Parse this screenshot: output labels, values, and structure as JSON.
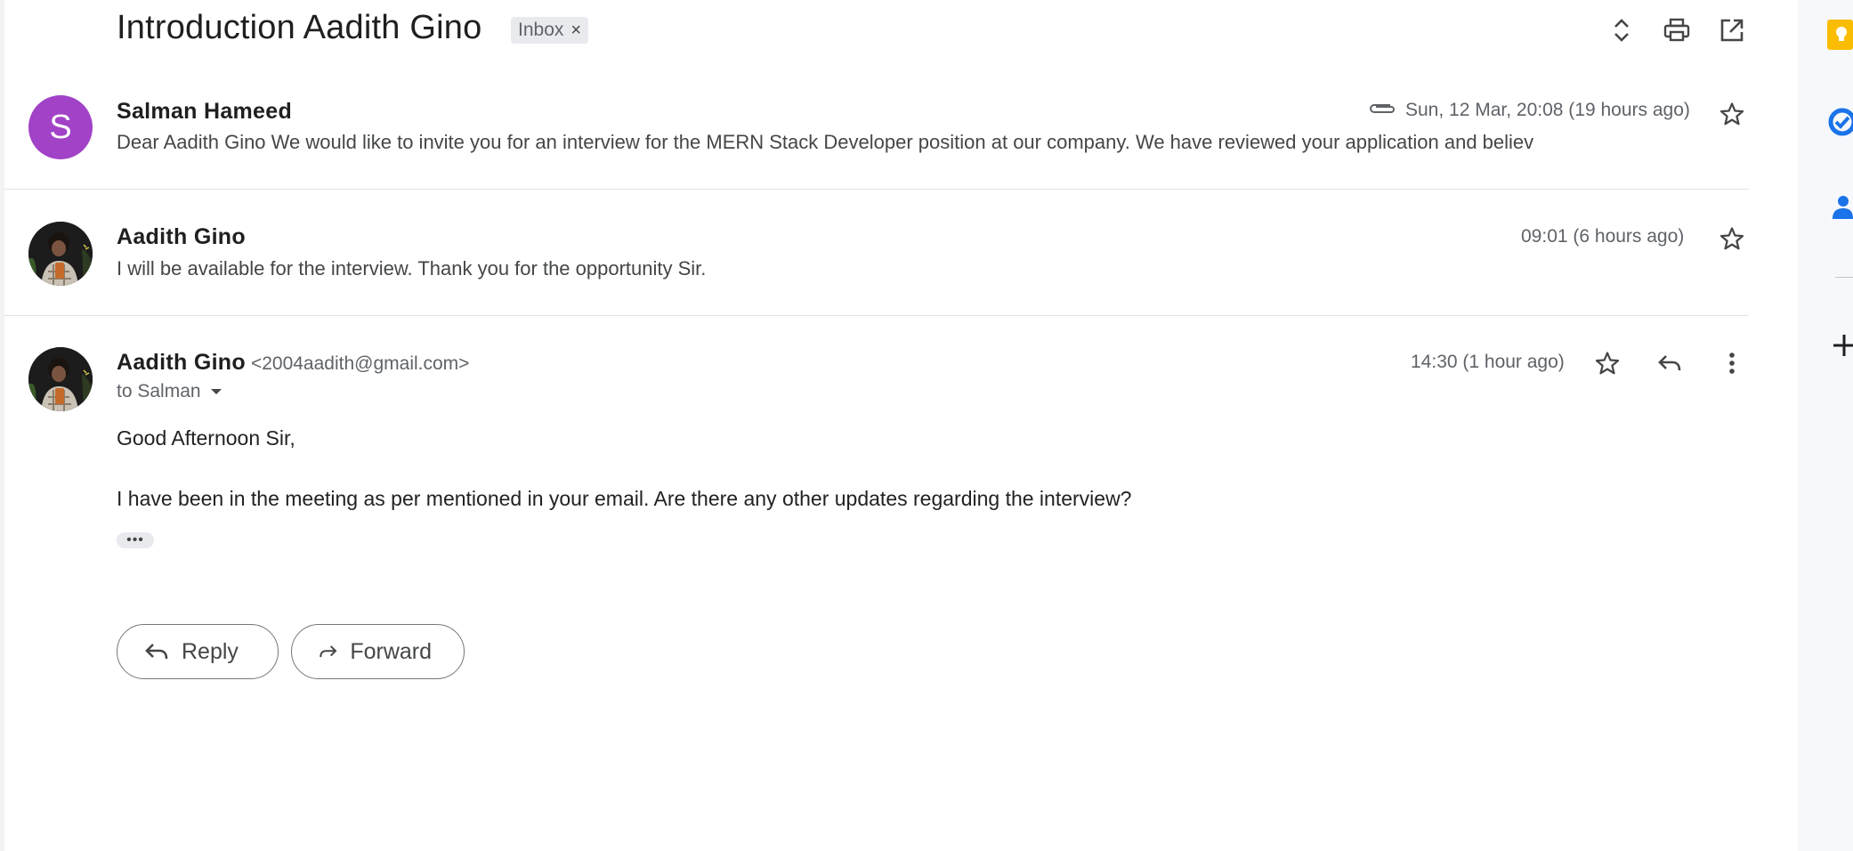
{
  "thread": {
    "subject": "Introduction Aadith Gino",
    "label": "Inbox",
    "label_remove": "×"
  },
  "toolbar_icons": [
    "expand-collapse-icon",
    "print-icon",
    "open-in-new-window-icon"
  ],
  "messages": [
    {
      "sender": "Salman Hameed",
      "avatar_letter": "S",
      "avatar_color": "#a142c7",
      "has_attachment": true,
      "time": "Sun, 12 Mar, 20:08 (19 hours ago)",
      "snippet": "Dear Aadith Gino We would like to invite you for an interview for the MERN Stack Developer position at our company. We have reviewed your application and believ"
    },
    {
      "sender": "Aadith Gino",
      "time": "09:01 (6 hours ago)",
      "snippet": "I will be available for the interview. Thank you for the opportunity Sir."
    }
  ],
  "open_message": {
    "sender": "Aadith Gino",
    "email": "<2004aadith@gmail.com>",
    "to": "to Salman",
    "time": "14:30 (1 hour ago)",
    "greeting": "Good Afternoon Sir,",
    "body": "I have been in the meeting as per mentioned in your email. Are there any other updates regarding the interview?",
    "trimmed_content": "•••"
  },
  "actions": {
    "reply": "Reply",
    "forward": "Forward"
  },
  "side_panel_icons": [
    "keep-icon",
    "tasks-icon",
    "contacts-icon",
    "add-addon-icon"
  ],
  "colors": {
    "keep": "#fbbc04",
    "tasks": "#1a73e8",
    "contacts": "#1a73e8"
  }
}
